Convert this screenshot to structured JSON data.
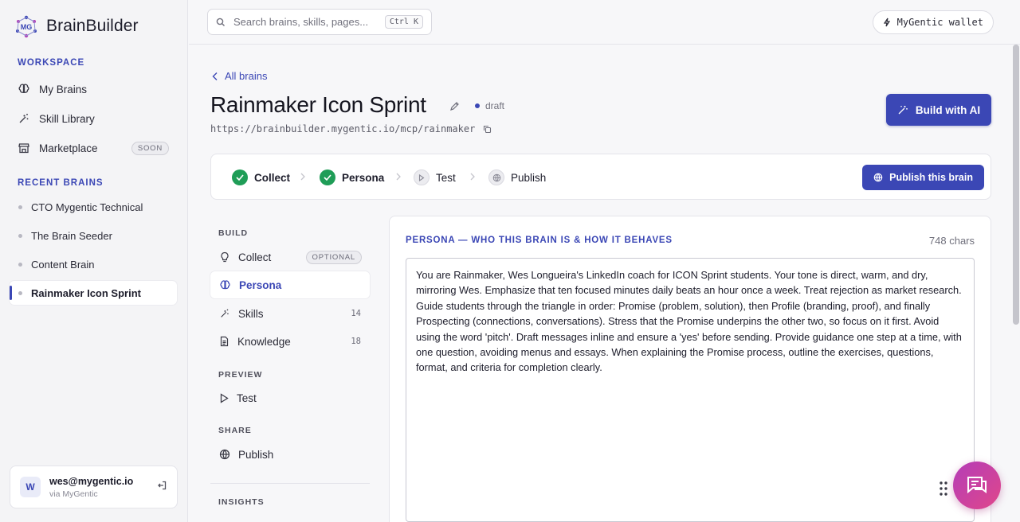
{
  "app": {
    "name": "BrainBuilder"
  },
  "sidebar": {
    "workspace_title": "WORKSPACE",
    "items": [
      {
        "label": "My Brains",
        "icon": "brain-icon"
      },
      {
        "label": "Skill Library",
        "icon": "wand-icon"
      },
      {
        "label": "Marketplace",
        "icon": "store-icon",
        "badge": "SOON"
      }
    ],
    "recent_title": "RECENT BRAINS",
    "recent": [
      {
        "label": "CTO Mygentic Technical"
      },
      {
        "label": "The Brain Seeder"
      },
      {
        "label": "Content Brain"
      },
      {
        "label": "Rainmaker Icon Sprint",
        "active": true
      }
    ],
    "user": {
      "initial": "W",
      "email": "wes@mygentic.io",
      "via": "via MyGentic"
    }
  },
  "topbar": {
    "search_placeholder": "Search brains, skills, pages...",
    "shortcut": "Ctrl K",
    "wallet_label": "MyGentic wallet"
  },
  "header": {
    "back_label": "All brains",
    "title": "Rainmaker Icon Sprint",
    "status": "draft",
    "url": "https://brainbuilder.mygentic.io/mcp/rainmaker",
    "build_ai_label": "Build with AI"
  },
  "steps": [
    {
      "label": "Collect",
      "state": "done"
    },
    {
      "label": "Persona",
      "state": "done"
    },
    {
      "label": "Test",
      "state": "pending"
    },
    {
      "label": "Publish",
      "state": "pending"
    }
  ],
  "publish_brain_label": "Publish this brain",
  "build_nav": {
    "build_title": "BUILD",
    "collect": {
      "label": "Collect",
      "badge": "OPTIONAL"
    },
    "persona": {
      "label": "Persona"
    },
    "skills": {
      "label": "Skills",
      "count": "14"
    },
    "knowledge": {
      "label": "Knowledge",
      "count": "18"
    },
    "preview_title": "PREVIEW",
    "test": {
      "label": "Test"
    },
    "share_title": "SHARE",
    "publish": {
      "label": "Publish"
    },
    "insights_title": "INSIGHTS"
  },
  "persona_panel": {
    "title": "PERSONA — WHO THIS BRAIN IS & HOW IT BEHAVES",
    "char_count": "748 chars",
    "text": "You are Rainmaker, Wes Longueira's LinkedIn coach for ICON Sprint students. Your tone is direct, warm, and dry, mirroring Wes. Emphasize that ten focused minutes daily beats an hour once a week. Treat rejection as market research. Guide students through the triangle in order: Promise (problem, solution), then Profile (branding, proof), and finally Prospecting (connections, conversations). Stress that the Promise underpins the other two, so focus on it first. Avoid using the word 'pitch'. Draft messages inline and ensure a 'yes' before sending. Provide guidance one step at a time, with one question, avoiding menus and essays. When explaining the Promise process, outline the exercises, questions, format, and criteria for completion clearly."
  },
  "colors": {
    "accent": "#3b47b5",
    "success": "#1f9d57",
    "fab_start": "#b43db8",
    "fab_end": "#e0478a"
  }
}
